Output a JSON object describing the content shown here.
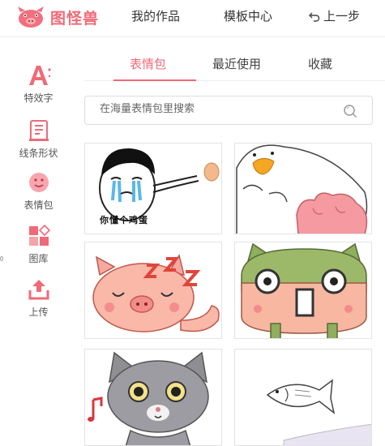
{
  "header": {
    "logo_text": "图怪兽",
    "nav": {
      "works": "我的作品",
      "templates": "模板中心",
      "undo": "上一步"
    }
  },
  "sidebar": {
    "items": [
      {
        "label": "特效字",
        "icon": "effect-text-icon"
      },
      {
        "label": "线条形状",
        "icon": "line-shape-icon"
      },
      {
        "label": "表情包",
        "icon": "emoji-icon"
      },
      {
        "label": "图库",
        "icon": "gallery-icon"
      },
      {
        "label": "上传",
        "icon": "upload-icon"
      }
    ]
  },
  "tabs": {
    "items": [
      "表情包",
      "最近使用",
      "收藏"
    ],
    "active": "表情包"
  },
  "search": {
    "placeholder": "在海量表情包里搜索"
  },
  "stickers": [
    {
      "caption": "你懂个鸡蛋"
    }
  ],
  "colors": {
    "accent": "#f06a78",
    "sidebar_icon": "#f06a78"
  }
}
